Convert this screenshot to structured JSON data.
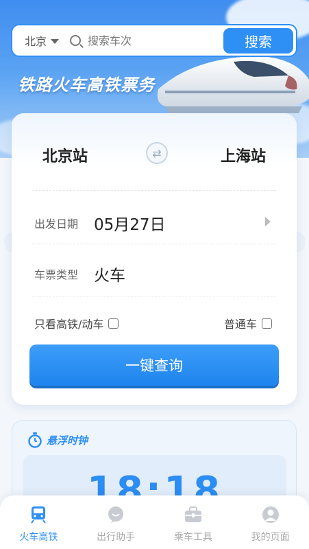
{
  "search": {
    "city": "北京",
    "placeholder": "搜索车次",
    "button_label": "搜索"
  },
  "hero": {
    "title": "铁路火车高铁票务"
  },
  "booking": {
    "from_station": "北京站",
    "to_station": "上海站",
    "date_label": "出发日期",
    "date_value": "05月27日",
    "type_label": "车票类型",
    "type_value": "火车",
    "filter_highspeed_label": "只看高铁/动车",
    "filter_normal_label": "普通车",
    "query_button_label": "一键查询"
  },
  "clock": {
    "title": "悬浮时钟",
    "time": "18:18"
  },
  "tabbar": {
    "items": [
      {
        "label": "火车高铁",
        "icon": "train-icon",
        "active": true
      },
      {
        "label": "出行助手",
        "icon": "chat-icon",
        "active": false
      },
      {
        "label": "乘车工具",
        "icon": "briefcase-icon",
        "active": false
      },
      {
        "label": "我的页面",
        "icon": "user-icon",
        "active": false
      }
    ]
  },
  "colors": {
    "accent": "#2e8ff5",
    "inactive": "#aaaaaa"
  }
}
